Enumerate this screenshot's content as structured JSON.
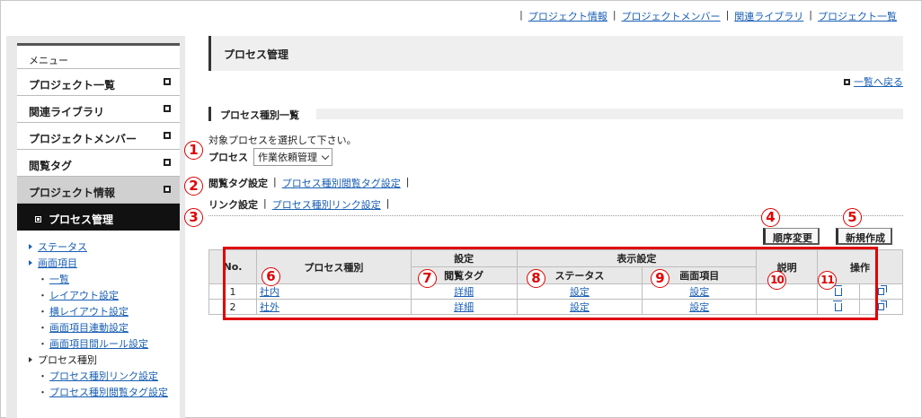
{
  "top_links": [
    "プロジェクト情報",
    "プロジェクトメンバー",
    "関連ライブラリ",
    "プロジェクト一覧"
  ],
  "sidebar": {
    "header": "メニュー",
    "items": [
      "プロジェクト一覧",
      "関連ライブラリ",
      "プロジェクトメンバー",
      "閲覧タグ",
      "プロジェクト情報"
    ],
    "active": "プロセス管理",
    "tree": {
      "status": "ステータス",
      "screen_items": "画面項目",
      "screen_children": [
        "一覧",
        "レイアウト設定",
        "横レイアウト設定",
        "画面項目連動設定",
        "画面項目間ルール設定"
      ],
      "process_types": "プロセス種別",
      "process_children": [
        "プロセス種別リンク設定",
        "プロセス種別閲覧タグ設定"
      ]
    }
  },
  "main": {
    "title": "プロセス管理",
    "back_link": "一覧へ戻る",
    "section_title": "プロセス種別一覧",
    "instruction": "対象プロセスを選択して下さい。",
    "process_label": "プロセス",
    "process_value": "作業依頼管理",
    "tag_setting_label": "閲覧タグ設定",
    "tag_setting_link": "プロセス種別閲覧タグ設定",
    "link_setting_label": "リンク設定",
    "link_setting_link": "プロセス種別リンク設定",
    "reorder_button": "順序変更",
    "new_button": "新規作成"
  },
  "table": {
    "headers": {
      "no": "No.",
      "type": "プロセス種別",
      "settings": "設定",
      "display_settings": "表示設定",
      "description": "説明",
      "operation": "操作",
      "tag": "閲覧タグ",
      "status": "ステータス",
      "screen": "画面項目"
    },
    "rows": [
      {
        "no": "1",
        "type": "社内",
        "tag": "詳細",
        "status": "設定",
        "screen": "設定"
      },
      {
        "no": "2",
        "type": "社外",
        "tag": "詳細",
        "status": "設定",
        "screen": "設定"
      }
    ]
  },
  "callouts": [
    "1",
    "2",
    "3",
    "4",
    "5",
    "6",
    "7",
    "8",
    "9",
    "10",
    "11"
  ],
  "colors": {
    "callout": "#e00000",
    "link": "#1a5fb4"
  }
}
